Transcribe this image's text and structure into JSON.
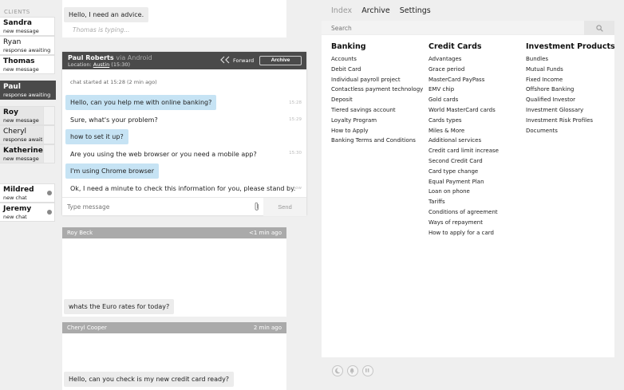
{
  "sidebar": {
    "label": "CLIENTS",
    "clients": [
      {
        "name": "Sandra",
        "status": "new message"
      },
      {
        "name": "Ryan",
        "status": "response awaiting"
      },
      {
        "name": "Thomas",
        "status": "new message"
      },
      {
        "name": "Paul",
        "status": "response awaiting"
      },
      {
        "name": "Roy",
        "status": "new message"
      },
      {
        "name": "Cheryl",
        "status": "response awaiting"
      },
      {
        "name": "Katherine",
        "status": "new message"
      },
      {
        "name": "Mildred",
        "status": "new chat"
      },
      {
        "name": "Jeremy",
        "status": "new chat"
      }
    ]
  },
  "top_card": {
    "message": "Hello, I need an advice.",
    "typing": "Thomas is typing..."
  },
  "chat": {
    "name": "Paul Roberts",
    "via": "via Android",
    "location_label": "Location:",
    "location_city": "Austin",
    "location_time": "(15:30)",
    "forward_label": "Forward",
    "archive_label": "Archive",
    "started": "chat started at 15:28 (2 min ago)",
    "messages": [
      {
        "text": "Hello, can you help me with online banking?",
        "time": "15:28"
      },
      {
        "text": "Sure, what's your problem?",
        "time": "15:29"
      },
      {
        "text": "how to set it up?",
        "time": ""
      },
      {
        "text": "Are you using the web browser or you need a mobile app?",
        "time": "15:30"
      },
      {
        "text": "I'm using Chrome browser",
        "time": ""
      },
      {
        "text": "Ok, I need a minute to check this information for you, please stand by.",
        "time": "now"
      }
    ],
    "input_placeholder": "Type message",
    "send_label": "Send"
  },
  "mini_chats": [
    {
      "name": "Roy Beck",
      "time": "<1 min ago",
      "message": "whats the Euro rates for today?"
    },
    {
      "name": "Cheryl Cooper",
      "time": "2 min ago",
      "message": "Hello, can you check is my new credit card ready?"
    }
  ],
  "nav": [
    "Index",
    "Archive",
    "Settings"
  ],
  "search": {
    "placeholder": "Search"
  },
  "columns": [
    {
      "title": "Banking",
      "links": [
        "Accounts",
        "Debit Card",
        "Individual payroll project",
        "Contactless payment technology",
        "Deposit",
        "Tiered savings account",
        "Loyalty Program",
        "How to Apply",
        "Banking Terms and Conditions"
      ]
    },
    {
      "title": "Credit Cards",
      "links": [
        "Advantages",
        "Grace period",
        "MasterCard PayPass",
        "EMV chip",
        "Gold cards",
        "World MasterCard cards",
        "Cards types",
        "Miles & More",
        "Additional services",
        "Credit card limit increase",
        "Second Credit Card",
        "Card type change",
        "Equal Payment Plan",
        "Loan on phone",
        "Tariffs",
        "Conditions of agreement",
        "Ways of repayment",
        "How to apply for a card"
      ]
    },
    {
      "title": "Investment Products",
      "links": [
        "Bundles",
        "Mutual Funds",
        "Fixed Income",
        "Offshore Banking",
        "Qualified Investor",
        "Investment Glossary",
        "Investment Risk Profiles",
        "Documents"
      ]
    }
  ],
  "icons": [
    "moon-icon",
    "bell-icon",
    "pause-icon"
  ]
}
